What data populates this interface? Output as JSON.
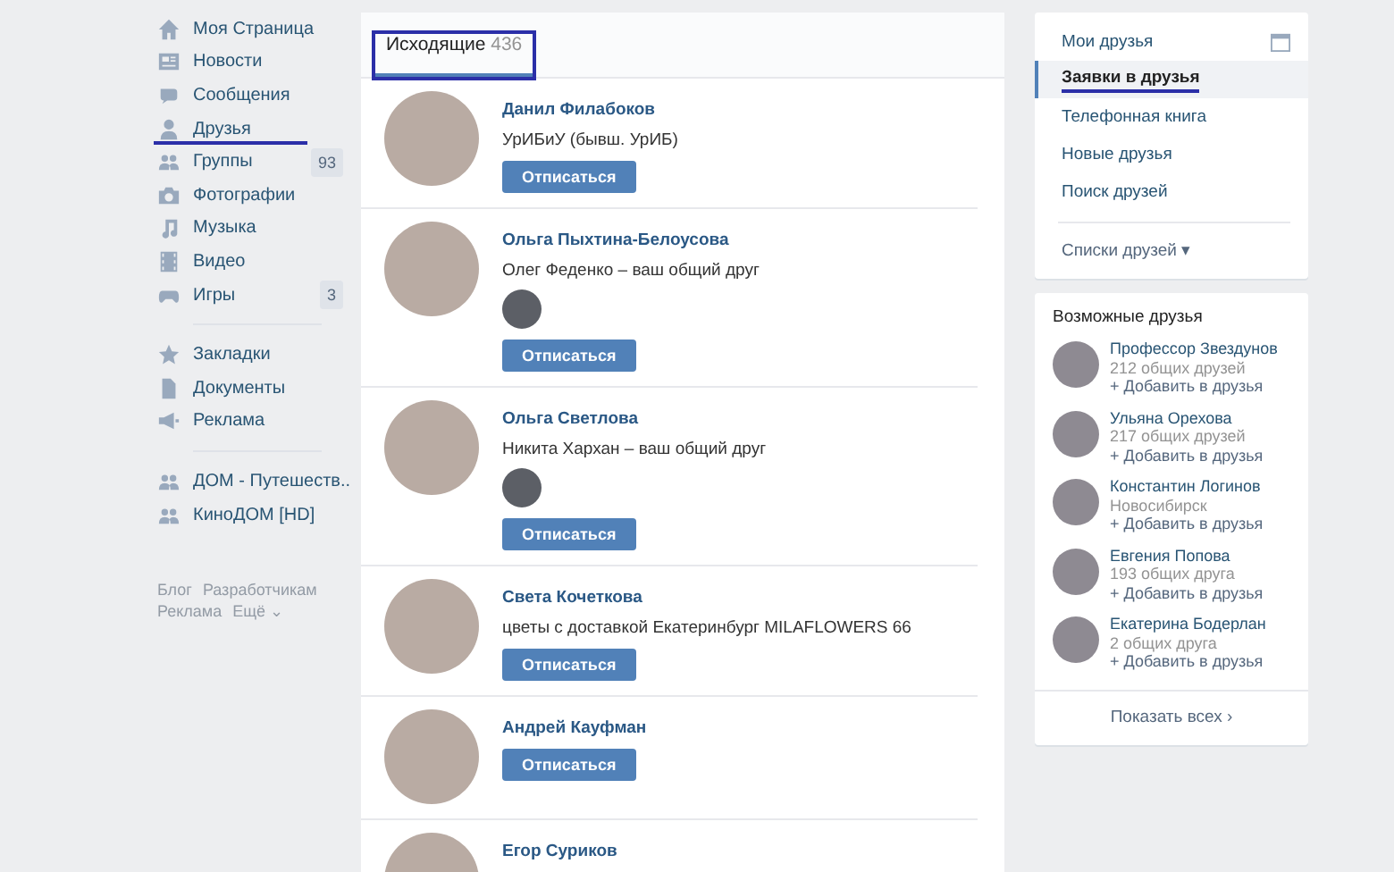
{
  "nav": {
    "sections": [
      {
        "items": [
          {
            "label": "Моя Страница",
            "marked": false
          },
          {
            "label": "Новости",
            "marked": false
          },
          {
            "label": "Сообщения",
            "marked": false
          },
          {
            "label": "Друзья",
            "marked": true
          },
          {
            "label": "Группы",
            "badge": "93",
            "marked": false
          },
          {
            "label": "Фотографии",
            "marked": false
          },
          {
            "label": "Музыка",
            "marked": false
          },
          {
            "label": "Видео",
            "marked": false
          },
          {
            "label": "Игры",
            "badge": "3",
            "marked": false
          }
        ]
      },
      {
        "items": [
          {
            "label": "Закладки",
            "marked": false
          },
          {
            "label": "Документы",
            "marked": false
          },
          {
            "label": "Реклама",
            "marked": false
          }
        ]
      },
      {
        "items": [
          {
            "label": "ДОМ - Путешеств..",
            "marked": false
          },
          {
            "label": "КиноДОМ [HD]",
            "marked": false
          }
        ]
      }
    ],
    "footer": [
      "Блог",
      "Разработчикам",
      "Реклама",
      "Ещё ⌄"
    ]
  },
  "tabs": [
    {
      "label": "Исходящие",
      "count": "436",
      "selected": true,
      "marked": true
    }
  ],
  "requests": [
    {
      "name": "Данил Филабоков",
      "subtitle": "УрИБиУ (бывш. УрИБ)",
      "mutual_avatar": false,
      "button": "Отписаться"
    },
    {
      "name": "Ольга Пыхтина-Белоусова",
      "subtitle": "Олег Феденко – ваш общий друг",
      "mutual_avatar": true,
      "button": "Отписаться"
    },
    {
      "name": "Ольга Светлова",
      "subtitle": "Никита Хархан – ваш общий друг",
      "mutual_avatar": true,
      "button": "Отписаться"
    },
    {
      "name": "Света Кочеткова",
      "subtitle": "цветы с доставкой Екатеринбург MILAFLOWERS 66",
      "mutual_avatar": false,
      "button": "Отписаться"
    },
    {
      "name": "Андрей Кауфман",
      "mutual_avatar": false,
      "button": "Отписаться"
    },
    {
      "name": "Егор Суриков",
      "mutual_avatar": false
    }
  ],
  "friends_menu": {
    "items": [
      {
        "label": "Мои друзья",
        "selected": false,
        "marked": false,
        "calendar": true
      },
      {
        "label": "Заявки в друзья",
        "selected": true,
        "marked": true,
        "calendar": false
      },
      {
        "label": "Телефонная книга",
        "selected": false,
        "marked": false,
        "calendar": false
      },
      {
        "label": "Новые друзья",
        "selected": false,
        "marked": false,
        "calendar": false
      },
      {
        "label": "Поиск друзей",
        "selected": false,
        "marked": false,
        "calendar": false
      }
    ],
    "lists": "Списки друзей ▾"
  },
  "possible_friends": {
    "title": "Возможные друзья",
    "people": [
      {
        "name": "Профессор Звездунов",
        "info": "212 общих друзей",
        "add": "+ Добавить в друзья"
      },
      {
        "name": "Ульяна Орехова",
        "info": "217 общих друзей",
        "add": "+ Добавить в друзья"
      },
      {
        "name": "Константин Логинов",
        "info": "Новосибирск",
        "add": "+ Добавить в друзья"
      },
      {
        "name": "Евгения Попова",
        "info": "193 общих друга",
        "add": "+ Добавить в друзья"
      },
      {
        "name": "Екатерина Бодерлан",
        "info": "2 общих друга",
        "add": "+ Добавить в друзья"
      }
    ],
    "show_all": "Показать всех ›"
  }
}
